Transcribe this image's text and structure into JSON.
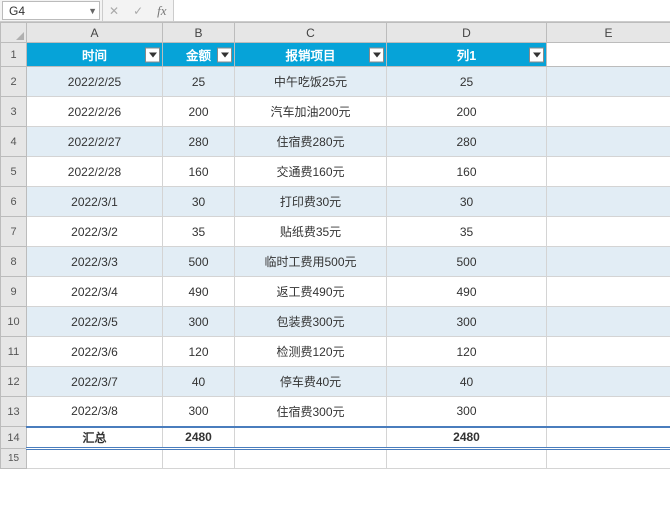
{
  "nameBox": {
    "value": "G4"
  },
  "formulaBar": {
    "cancel": "✕",
    "confirm": "✓",
    "fx": "fx",
    "value": ""
  },
  "columns": [
    "A",
    "B",
    "C",
    "D",
    "E"
  ],
  "rowNumsHeader": 1,
  "headers": {
    "A": "时间",
    "B": "金额",
    "C": "报销项目",
    "D": "列1"
  },
  "rows": [
    {
      "n": 2,
      "A": "2022/2/25",
      "B": "25",
      "C": "中午吃饭25元",
      "D": "25",
      "alt": true
    },
    {
      "n": 3,
      "A": "2022/2/26",
      "B": "200",
      "C": "汽车加油200元",
      "D": "200",
      "alt": false
    },
    {
      "n": 4,
      "A": "2022/2/27",
      "B": "280",
      "C": "住宿费280元",
      "D": "280",
      "alt": true
    },
    {
      "n": 5,
      "A": "2022/2/28",
      "B": "160",
      "C": "交通费160元",
      "D": "160",
      "alt": false
    },
    {
      "n": 6,
      "A": "2022/3/1",
      "B": "30",
      "C": "打印费30元",
      "D": "30",
      "alt": true
    },
    {
      "n": 7,
      "A": "2022/3/2",
      "B": "35",
      "C": "贴纸费35元",
      "D": "35",
      "alt": false
    },
    {
      "n": 8,
      "A": "2022/3/3",
      "B": "500",
      "C": "临时工费用500元",
      "D": "500",
      "alt": true
    },
    {
      "n": 9,
      "A": "2022/3/4",
      "B": "490",
      "C": "返工费490元",
      "D": "490",
      "alt": false
    },
    {
      "n": 10,
      "A": "2022/3/5",
      "B": "300",
      "C": "包装费300元",
      "D": "300",
      "alt": true
    },
    {
      "n": 11,
      "A": "2022/3/6",
      "B": "120",
      "C": "检测费120元",
      "D": "120",
      "alt": false
    },
    {
      "n": 12,
      "A": "2022/3/7",
      "B": "40",
      "C": "停车费40元",
      "D": "40",
      "alt": true
    },
    {
      "n": 13,
      "A": "2022/3/8",
      "B": "300",
      "C": "住宿费300元",
      "D": "300",
      "alt": false
    }
  ],
  "summary": {
    "n": 14,
    "A": "汇总",
    "B": "2480",
    "C": "",
    "D": "2480"
  },
  "trailingRows": [
    15
  ]
}
